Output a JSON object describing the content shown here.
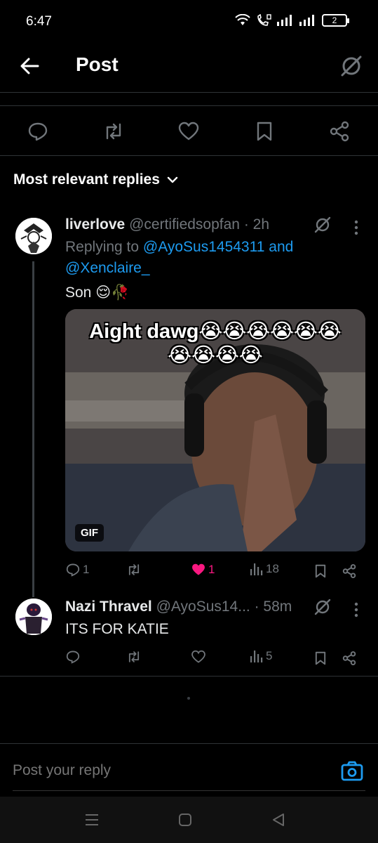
{
  "status_bar": {
    "time": "6:47",
    "battery": "2"
  },
  "header": {
    "title": "Post"
  },
  "filter": {
    "label": "Most relevant replies"
  },
  "replies": [
    {
      "name": "liverlove",
      "handle": "@certifiedsopfan",
      "time": "· 2h",
      "replying_prefix": "Replying to",
      "mention1": "@AyoSus1454311",
      "and": "and",
      "mention2": "@Xenclaire_",
      "text": "Son 😌🥀",
      "media": {
        "caption_line1": "Aight dawg😭😭😭😭😭😭",
        "caption_line2": "😭😭😭😭",
        "badge": "GIF"
      },
      "metrics": {
        "replies": "1",
        "likes": "1",
        "views": "18"
      }
    },
    {
      "name": "Nazi Thravel",
      "handle": "@AyoSus14...",
      "time": "· 58m",
      "text": "ITS FOR KATIE",
      "metrics": {
        "views": "5"
      }
    }
  ],
  "reply_box": {
    "placeholder": "Post your reply"
  },
  "colors": {
    "accent": "#1d9bf0",
    "like": "#f91880",
    "muted": "#71767b",
    "border": "#2f3336"
  },
  "icons": [
    "wifi-icon",
    "call-icon",
    "signal-icon",
    "battery-icon",
    "back-arrow-icon",
    "grok-icon",
    "reply-icon",
    "repost-icon",
    "like-icon",
    "bookmark-icon",
    "share-icon",
    "chevron-down-icon",
    "more-icon",
    "views-icon",
    "camera-icon",
    "menu-icon",
    "home-icon",
    "back-triangle-icon"
  ]
}
